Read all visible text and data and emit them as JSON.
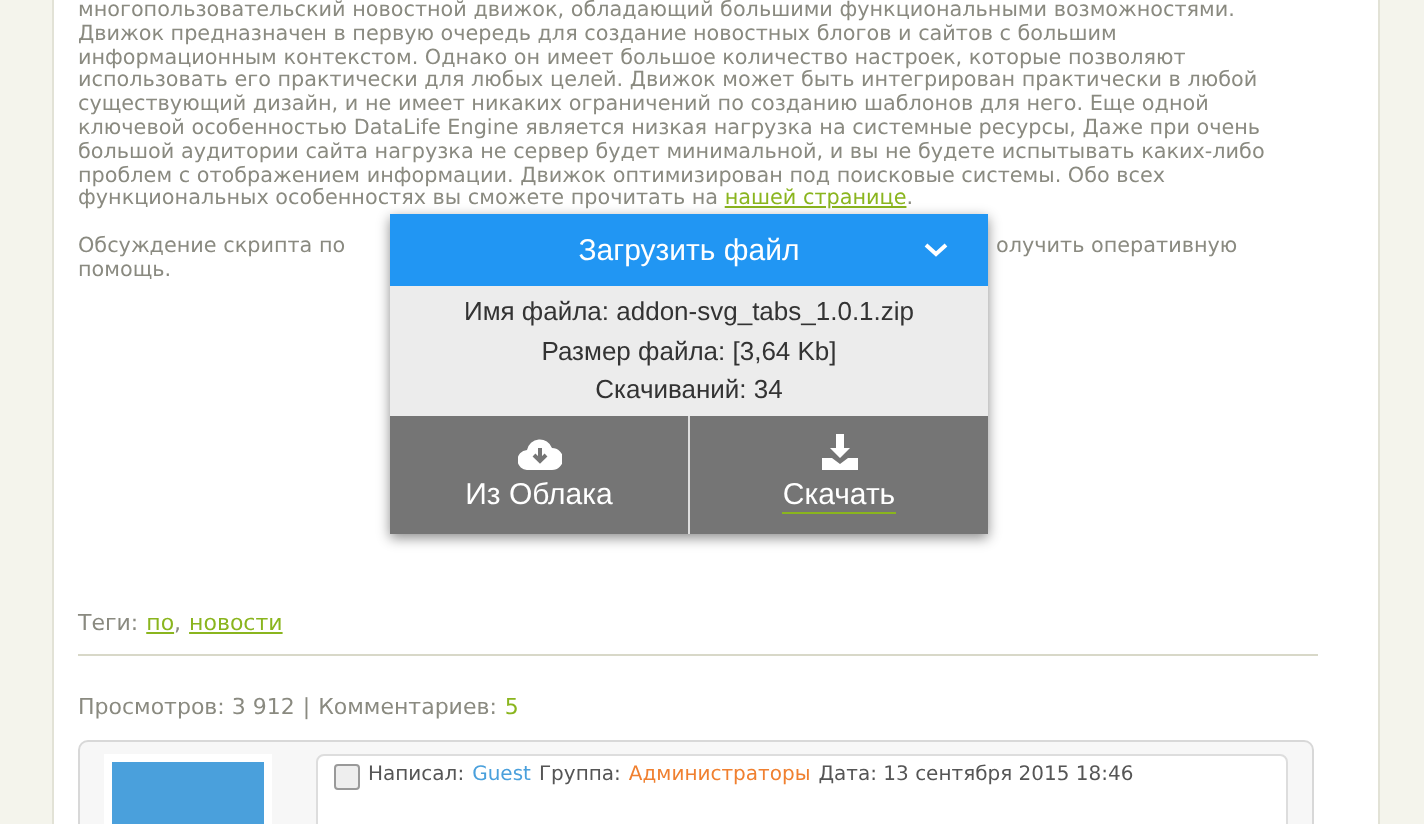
{
  "article": {
    "body_lines": [
      "многопользовательский новостной движок, обладающий большими функциональными возможностями.",
      "Движок предназначен в первую очередь для создание новостных блогов и сайтов с большим",
      "информационным контекстом. Однако он имеет большое количество настроек, которые позволяют",
      "использовать его практически для любых целей. Движок может быть интегрирован практически в любой",
      "существующий дизайн, и не имеет никаких ограничений по созданию шаблонов для него. Еще одной",
      "ключевой особенностью DataLife Engine является низкая нагрузка на системные ресурсы, Даже при очень",
      "большой аудитории сайта нагрузка не сервер будет минимальной, и вы не будете испытывать каких-либо",
      "проблем с отображением информации. Движок оптимизирован под поисковые системы. Обо всех",
      "функциональных особенностях вы сможете прочитать на"
    ],
    "link": "нашей странице",
    "end": ".",
    "discussion_left": "Обсуждение скрипта по",
    "discussion_right": "олучить оперативную",
    "discussion_line2": "помощь."
  },
  "download": {
    "title": "Загрузить файл",
    "file_name": "Имя файла: addon-svg_tabs_1.0.1.zip",
    "file_size": "Размер файла: [3,64 Kb]",
    "downloads": "Скачиваний: 34",
    "buttons": [
      {
        "kind": "cloud",
        "label": "Из Облака"
      },
      {
        "kind": "download",
        "label": "Скачать"
      }
    ]
  },
  "tags": {
    "label": "Теги:",
    "items": [
      "по",
      "новости"
    ],
    "separator": ","
  },
  "stats": {
    "views": "Просмотров: 3 912",
    "separator": "|",
    "comments_label": "Комментариев:",
    "comments": "5"
  },
  "comment": {
    "checked": false,
    "author_label": "Написал:",
    "author": "Guest",
    "group_label": "Группа:",
    "group": "Администраторы",
    "date": "Дата: 13 сентября 2015 18:46"
  }
}
